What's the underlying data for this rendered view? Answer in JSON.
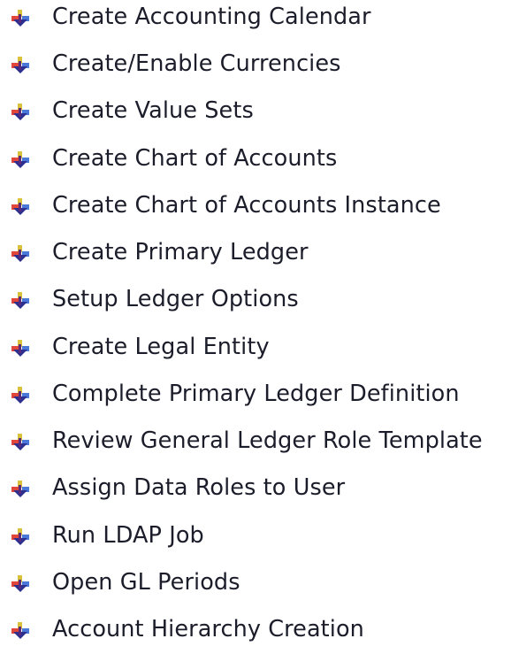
{
  "list": {
    "icon": "down-arrow-bullet-icon",
    "icon_colors": {
      "top": "#d9c13a",
      "left": "#e0463a",
      "right": "#4a78d8",
      "bottom": "#2d2f8f"
    },
    "items": [
      {
        "label": "Create Accounting Calendar"
      },
      {
        "label": "Create/Enable Currencies"
      },
      {
        "label": "Create Value Sets"
      },
      {
        "label": "Create Chart of Accounts"
      },
      {
        "label": "Create Chart of Accounts Instance"
      },
      {
        "label": "Create Primary Ledger"
      },
      {
        "label": "Setup Ledger Options"
      },
      {
        "label": "Create Legal Entity"
      },
      {
        "label": "Complete Primary Ledger Definition"
      },
      {
        "label": "Review General Ledger Role Template"
      },
      {
        "label": "Assign Data Roles to User"
      },
      {
        "label": "Run LDAP Job"
      },
      {
        "label": "Open GL Periods"
      },
      {
        "label": "Account Hierarchy Creation"
      }
    ]
  }
}
